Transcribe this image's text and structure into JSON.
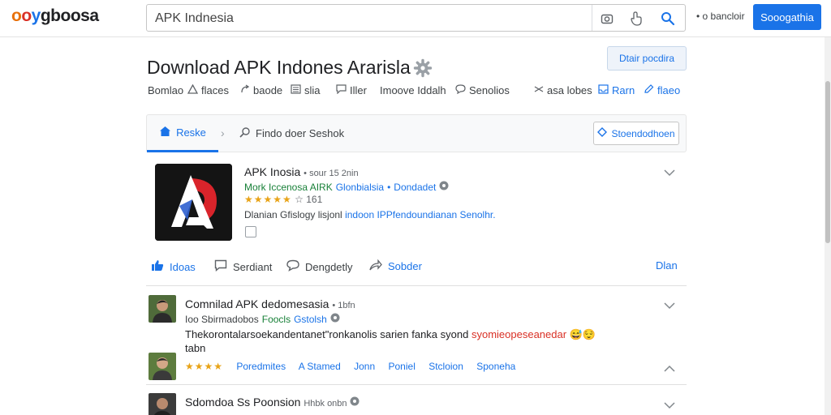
{
  "brand": {
    "logo": [
      "o",
      "o",
      "y",
      "gboosa"
    ]
  },
  "search": {
    "value": "APK Indnesia"
  },
  "header": {
    "top_right_text": "• o bancloir",
    "signin_label": "Sooogathia"
  },
  "page": {
    "title": "Download APK Indones Ararisla",
    "edit_label": "Dtair pocdira"
  },
  "toolbar": {
    "items": [
      "Bomlao",
      "flaces",
      "baode",
      "slia",
      "Iller",
      "Imoove Iddalh",
      "Senolios",
      "asa lobes",
      "Rarn",
      "flaeo"
    ]
  },
  "tabs": {
    "active_label": "Reske",
    "breadcrumb_label": "Findo doer Seshok",
    "button_label": "Stoendodhoen"
  },
  "app": {
    "name": "APK Inosia",
    "meta": "• sour 15 2nin",
    "dev_green": "Mork Iccenosa AIRK",
    "dev_blue": "Glonbialsia",
    "dev_sep": "•",
    "dev_action": "Dondadet",
    "stars": "★★★★★",
    "rating_count": "☆ 161",
    "desc_plain": "Dlanian Gfislogy lisjonl",
    "desc_blue": "indoon IPPfendoundianan Senolhr."
  },
  "actions": {
    "likes": "Idoas",
    "share": "Serdiant",
    "dislike": "Dengdetly",
    "forward": "Sobder",
    "more": "Dlan"
  },
  "posts": [
    {
      "title": "Comnilad APK dedomesasia",
      "meta": "• 1bfn",
      "sub_plain": "Ioo Sbirmadobos",
      "sub_green": "Foocls",
      "sub_blue": "Gstolsh",
      "body_plain": "Thekorontalarsoekandentanet\"ronkanolis sarien fanka syond",
      "body_red": "syomieopeseanedar",
      "body_emoji": "😅😌",
      "body_line2": "tabn"
    },
    {
      "stars": "★★★★",
      "tags": [
        "Poredmites",
        "A Stamed",
        "Jonn",
        "Poniel",
        "Stcloion",
        "Sponeha"
      ]
    },
    {
      "title": "Sdomdoa Ss Poonsion",
      "meta": "Hhbk onbn"
    }
  ]
}
